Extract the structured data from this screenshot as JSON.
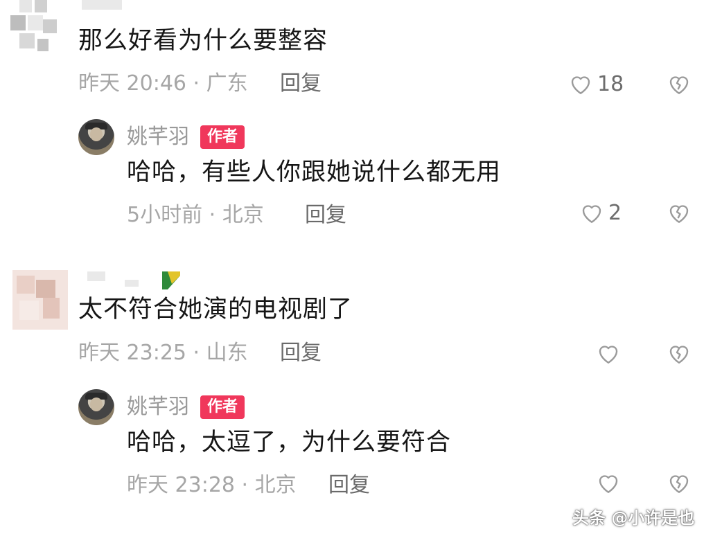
{
  "comments": [
    {
      "text": "那么好看为什么要整容",
      "time": "昨天 20:46 ·",
      "location": "广东",
      "reply_label": "回复",
      "like_count": "18",
      "reply": {
        "author": "姚芊羽",
        "badge": "作者",
        "text": "哈哈，有些人你跟她说什么都无用",
        "time": "5小时前 ·",
        "location": "北京",
        "reply_label": "回复",
        "like_count": "2"
      }
    },
    {
      "text": "太不符合她演的电视剧了",
      "time": "昨天 23:25 ·",
      "location": "山东",
      "reply_label": "回复",
      "like_count": "",
      "reply": {
        "author": "姚芊羽",
        "badge": "作者",
        "text": "哈哈，太逗了，为什么要符合",
        "time": "昨天 23:28 ·",
        "location": "北京",
        "reply_label": "回复",
        "like_count": ""
      }
    }
  ],
  "watermark": "头条 @小许是也",
  "icons": {
    "like": "heart-outline-icon",
    "dislike": "broken-heart-icon"
  },
  "colors": {
    "badge": "#f0375b",
    "meta": "#a6a6a6"
  }
}
